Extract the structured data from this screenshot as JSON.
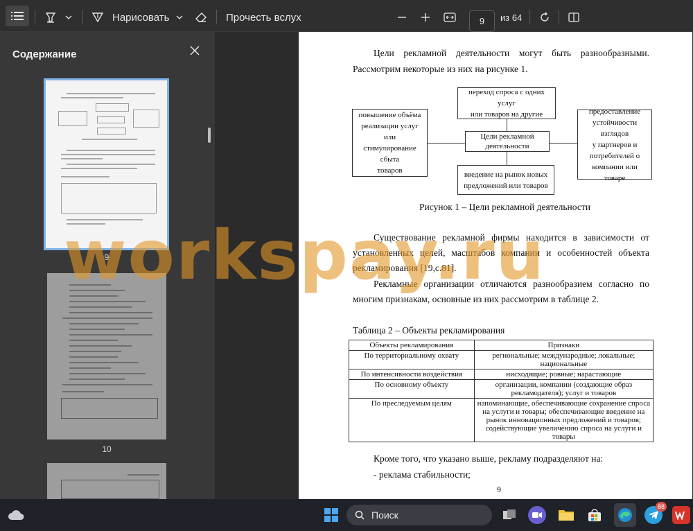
{
  "toolbar": {
    "draw_label": "Нарисовать",
    "read_aloud_label": "Прочесть вслух",
    "page_current": "9",
    "page_total": "из 64"
  },
  "sidebar": {
    "title": "Содержание",
    "thumbnails": [
      {
        "num": "9"
      },
      {
        "num": "10"
      }
    ]
  },
  "document": {
    "intro_line1": "Цели рекламной деятельности могут быть разнообразными.",
    "intro_line2": "Рассмотрим некоторые из них  на рисунке 1.",
    "diagram": {
      "top_line1": "переход спроса с одних услуг",
      "top_line2": "или товаров на другие",
      "left_line1": "повышение объёма",
      "left_line2": "реализации услуг или",
      "left_line3": "стимулирование сбыта",
      "left_line4": "товаров",
      "center_line1": "Цели рекламной",
      "center_line2": "деятельности",
      "right_line1": "предоставление",
      "right_line2": "устойчивости взглядов",
      "right_line3": "у партнеров и",
      "right_line4": "потребителей о",
      "right_line5": "компании или товаре",
      "bottom_line1": "введение на рынок новых",
      "bottom_line2": "предложений или товаров"
    },
    "figure_caption": "Рисунок 1 – Цели рекламной деятельности",
    "para1_line1": "Существование рекламной фирмы находится в зависимости от",
    "para1_line2": "установленных целей, масштабов компании и особенностей объекта",
    "para1_line3": "рекламирования [19,с.81].",
    "para2_line1": "Рекламные организации отличаются разнообразием согласно по",
    "para2_line2": "многим признакам, основные из них рассмотрим в таблице 2.",
    "table_caption": "Таблица 2 – Объекты рекламирования",
    "table": {
      "headers": [
        "Объекты рекламирования",
        "Признаки"
      ],
      "rows": [
        [
          "По территориальному охвату",
          "региональные; международные; локальные; национальные"
        ],
        [
          "По интенсивности воздействия",
          "нисходящие; ровные; нарастающие"
        ],
        [
          "По основному объекту",
          "организации, компании (создающие образ рекламодателя); услуг и товаров"
        ],
        [
          "По преследуемым целям",
          "напоминающие, обеспечивающие сохранение спроса на услуги и товары; обеспечивающие введение на рынок инновационных предложений и товаров; содействующие увеличению спроса на услуги и товары"
        ]
      ]
    },
    "after_line1": "Кроме того, что указано выше, рекламу подразделяют на:",
    "after_line2": "- реклама стабильности;",
    "page_number": "9"
  },
  "watermark": "workspay.ru",
  "taskbar": {
    "search_label": "Поиск",
    "telegram_badge": "88"
  }
}
